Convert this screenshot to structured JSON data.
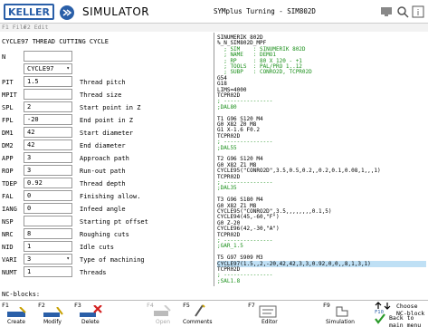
{
  "title_bar": {
    "logo_text": "KELLER",
    "app_name": "SIMULATOR",
    "window_title": "SYMplus Turning - SIM802D"
  },
  "menu": {
    "items": [
      "F1 File",
      "F2 Edit"
    ]
  },
  "left_panel": {
    "title": "CYCLE97 THREAD CUTTING CYCLE",
    "rows": [
      {
        "label": "N",
        "value": "",
        "desc": ""
      },
      {
        "label": "",
        "value": "CYCLE97",
        "desc": "",
        "dropdown": true
      },
      {
        "label": "PIT",
        "value": "1.5",
        "desc": "Thread pitch"
      },
      {
        "label": "MPIT",
        "value": "",
        "desc": "Thread size"
      },
      {
        "label": "SPL",
        "value": "2",
        "desc": "Start point in Z"
      },
      {
        "label": "FPL",
        "value": "-20",
        "desc": "End point in Z"
      },
      {
        "label": "DM1",
        "value": "42",
        "desc": "Start diameter"
      },
      {
        "label": "DM2",
        "value": "42",
        "desc": "End diameter"
      },
      {
        "label": "APP",
        "value": "3",
        "desc": "Approach path"
      },
      {
        "label": "ROP",
        "value": "3",
        "desc": "Run-out path"
      },
      {
        "label": "TDEP",
        "value": "0.92",
        "desc": "Thread depth"
      },
      {
        "label": "FAL",
        "value": "0",
        "desc": "Finishing allow."
      },
      {
        "label": "IANG",
        "value": "0",
        "desc": "Infeed angle"
      },
      {
        "label": "NSP",
        "value": "",
        "desc": "Starting pt offset"
      },
      {
        "label": "NRC",
        "value": "8",
        "desc": "Roughing cuts"
      },
      {
        "label": "NID",
        "value": "1",
        "desc": "Idle cuts"
      },
      {
        "label": "VARI",
        "value": "3",
        "desc": "Type of machining",
        "dropdown": true
      },
      {
        "label": "NUMT",
        "value": "1",
        "desc": "Threads"
      }
    ]
  },
  "code": {
    "lines": [
      {
        "t": "SINUMERIK 802D",
        "c": ""
      },
      {
        "t": "%_N_SIM802D_MPF",
        "c": ""
      },
      {
        "t": "  ; SIM    : SINUMERIK 802D",
        "c": "green"
      },
      {
        "t": "  ; NAME   : DEMO1",
        "c": "green"
      },
      {
        "t": "  ; RP     : 80 X 120 - +1",
        "c": "green"
      },
      {
        "t": "  ; TOOLS  : PAL/PRO 1..12",
        "c": "green"
      },
      {
        "t": "  ; SUBP   : CONRO2D, TCPR02D",
        "c": "green"
      },
      {
        "t": "G54",
        "c": ""
      },
      {
        "t": "G18",
        "c": ""
      },
      {
        "t": "LIMS=4000",
        "c": ""
      },
      {
        "t": "TCPR02D",
        "c": ""
      },
      {
        "t": "; ---------------",
        "c": "green"
      },
      {
        "t": ";DAL80",
        "c": "green"
      },
      {
        "t": "",
        "c": ""
      },
      {
        "t": "T1 G96 S120 M4",
        "c": ""
      },
      {
        "t": "G0 X82 Z0 M8",
        "c": ""
      },
      {
        "t": "G1 X-1.6 F0.2",
        "c": ""
      },
      {
        "t": "TCPR02D",
        "c": ""
      },
      {
        "t": "; ---------------",
        "c": "green"
      },
      {
        "t": ";DAL55",
        "c": "green"
      },
      {
        "t": "",
        "c": ""
      },
      {
        "t": "T2 G96 S120 M4",
        "c": ""
      },
      {
        "t": "G0 X82 Z1 M8",
        "c": ""
      },
      {
        "t": "CYCLE95(\"CONRO2D\",3.5,0.5,0.2,,0.2,0.1,0.08,1,,,1)",
        "c": ""
      },
      {
        "t": "TCPR02D",
        "c": ""
      },
      {
        "t": "; ---------------",
        "c": "green"
      },
      {
        "t": ";DAL35",
        "c": "green"
      },
      {
        "t": "",
        "c": ""
      },
      {
        "t": "T3 G96 S180 M4",
        "c": ""
      },
      {
        "t": "G0 X82 Z1 M8",
        "c": ""
      },
      {
        "t": "CYCLE95(\"CONRO2D\",3.5,,,,,,,,0.1,5)",
        "c": ""
      },
      {
        "t": "CYCLE94(45,-60,\"F\")",
        "c": ""
      },
      {
        "t": "G0 Z-20",
        "c": ""
      },
      {
        "t": "CYCLE96(42,-30,\"A\")",
        "c": ""
      },
      {
        "t": "TCPR02D",
        "c": ""
      },
      {
        "t": "; ---------------",
        "c": "green"
      },
      {
        "t": ";GAR_1.5",
        "c": "green"
      },
      {
        "t": "",
        "c": ""
      },
      {
        "t": "T5 G97 S909 M3",
        "c": ""
      },
      {
        "t": "CYCLE97(1.5,,2,-20,42,42,3,3,0.92,0,0,,8,1,3,1)",
        "c": "",
        "hl": true
      },
      {
        "t": "TCPR02D",
        "c": ""
      },
      {
        "t": "; ---------------",
        "c": "green"
      },
      {
        "t": ";SAL1.8",
        "c": "green"
      }
    ]
  },
  "bottom": {
    "nc_blocks_label": "NC-blocks:",
    "fkeys": [
      {
        "num": "F1",
        "name": "Create",
        "disabled": false
      },
      {
        "num": "F2",
        "name": "Modify",
        "disabled": false
      },
      {
        "num": "F3",
        "name": "Delete",
        "disabled": false
      },
      {
        "num": "F4",
        "name": "Open",
        "disabled": true
      },
      {
        "num": "F5",
        "name": "Comments",
        "disabled": false
      },
      {
        "num": "F7",
        "name": "Editor",
        "disabled": false
      },
      {
        "num": "F9",
        "name": "Simulation",
        "disabled": false
      }
    ],
    "choose_label": "Choose NC-block",
    "f10_label": "F10",
    "back_label": "Back to main menu"
  },
  "colors": {
    "accent": "#2a5fa8",
    "comment_green": "#1a8f1a",
    "highlight": "#bfe0f5",
    "delete_red": "#d32020"
  }
}
